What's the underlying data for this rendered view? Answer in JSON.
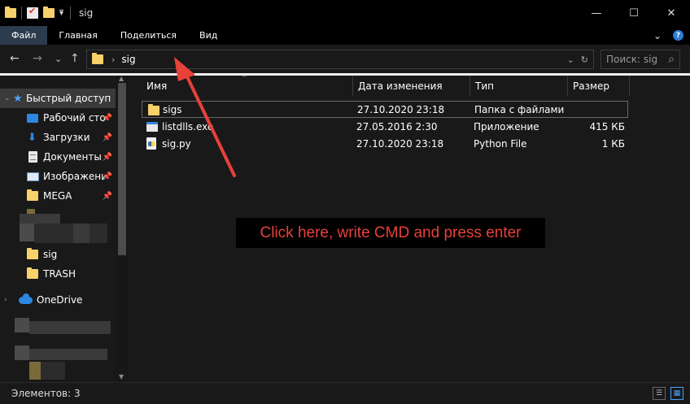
{
  "window": {
    "title": "sig",
    "minimize_glyph": "—",
    "maximize_glyph": "☐",
    "close_glyph": "✕"
  },
  "ribbon": {
    "tabs": [
      {
        "label": "Файл"
      },
      {
        "label": "Главная"
      },
      {
        "label": "Поделиться"
      },
      {
        "label": "Вид"
      }
    ],
    "help_glyph": "?",
    "expand_glyph": "⌄"
  },
  "nav": {
    "back_glyph": "←",
    "forward_glyph": "→",
    "recent_glyph": "⌄",
    "up_glyph": "↑",
    "address": {
      "separator": "›",
      "crumb": "sig",
      "dropdown_glyph": "⌄",
      "refresh_glyph": "↻"
    },
    "search": {
      "placeholder": "Поиск: sig",
      "icon_glyph": "⌕"
    }
  },
  "sidebar": {
    "quick_access": "Быстрый доступ",
    "items": [
      {
        "label": "Рабочий сто...",
        "icon": "desktop-icon",
        "pinned": true
      },
      {
        "label": "Загрузки",
        "icon": "download-icon",
        "pinned": true
      },
      {
        "label": "Документы",
        "icon": "documents-icon",
        "pinned": true
      },
      {
        "label": "Изображени...",
        "icon": "pictures-icon",
        "pinned": true
      },
      {
        "label": "MEGA",
        "icon": "folder-icon",
        "pinned": true
      },
      {
        "label": "sig",
        "icon": "folder-icon",
        "pinned": false
      },
      {
        "label": "TRASH",
        "icon": "folder-icon",
        "pinned": false
      }
    ],
    "onedrive": "OneDrive",
    "pin_glyph": "📌",
    "chevron_glyph": "›"
  },
  "filelist": {
    "columns": [
      "Имя",
      "Дата изменения",
      "Тип",
      "Размер"
    ],
    "sort_caret": "^",
    "rows": [
      {
        "name": "sigs",
        "date": "27.10.2020 23:18",
        "type": "Папка с файлами",
        "size": "",
        "icon": "folder-icon"
      },
      {
        "name": "listdlls.exe",
        "date": "27.05.2016 2:30",
        "type": "Приложение",
        "size": "415 КБ",
        "icon": "exe-icon"
      },
      {
        "name": "sig.py",
        "date": "27.10.2020 23:18",
        "type": "Python File",
        "size": "1 КБ",
        "icon": "python-file-icon"
      }
    ]
  },
  "annotation": {
    "text": "Click here, write CMD and press enter",
    "color": "#e8413a"
  },
  "status": {
    "items_count": "Элементов: 3"
  },
  "colors": {
    "accent": "#2e87e0",
    "folder": "#f7d26a",
    "background": "#191919"
  }
}
